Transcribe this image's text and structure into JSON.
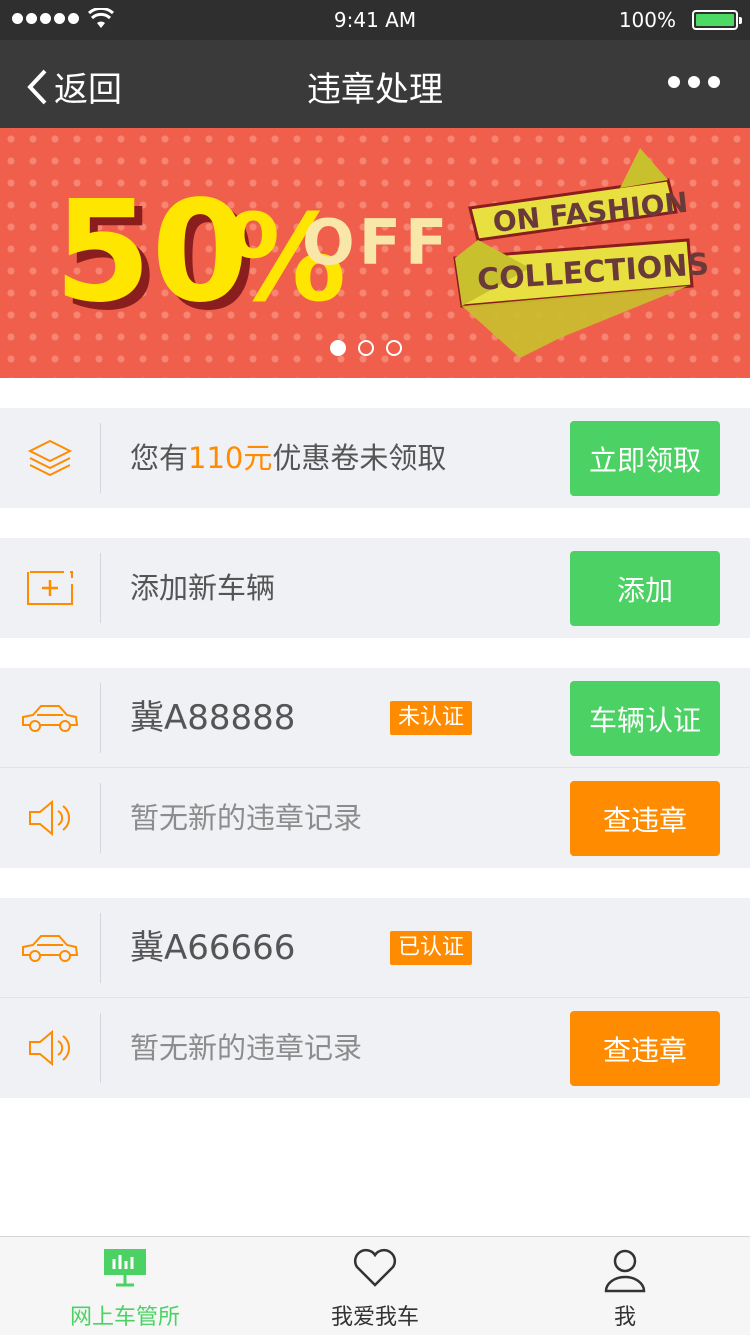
{
  "status_bar": {
    "time": "9:41 AM",
    "battery": "100%"
  },
  "nav": {
    "back_label": "返回",
    "title": "违章处理"
  },
  "banner": {
    "big_text": "50",
    "percent": "%",
    "off_text": "OFF",
    "ribbon_line1": "ON FASHION",
    "ribbon_line2": "COLLECTIONS",
    "slide_count": 3,
    "active_slide": 1
  },
  "coupon": {
    "prefix": "您有",
    "amount": "110元",
    "suffix": "优惠卷未领取",
    "button": "立即领取"
  },
  "add_vehicle": {
    "label": "添加新车辆",
    "button": "添加"
  },
  "vehicles": [
    {
      "plate": "冀A88888",
      "status_tag": "未认证",
      "action_button": "车辆认证",
      "record_text": "暂无新的违章记录",
      "record_button": "查违章"
    },
    {
      "plate": "冀A66666",
      "status_tag": "已认证",
      "record_text": "暂无新的违章记录",
      "record_button": "查违章"
    }
  ],
  "tabbar": {
    "items": [
      {
        "label": "网上车管所",
        "icon": "dashboard-icon",
        "active": true
      },
      {
        "label": "我爱我车",
        "icon": "heart-icon",
        "active": false
      },
      {
        "label": "我",
        "icon": "user-icon",
        "active": false
      }
    ]
  },
  "colors": {
    "green": "#4cd264",
    "orange": "#ff8c00",
    "nav_bg": "#3a3a3a",
    "banner_bg": "#ef5f4c"
  }
}
